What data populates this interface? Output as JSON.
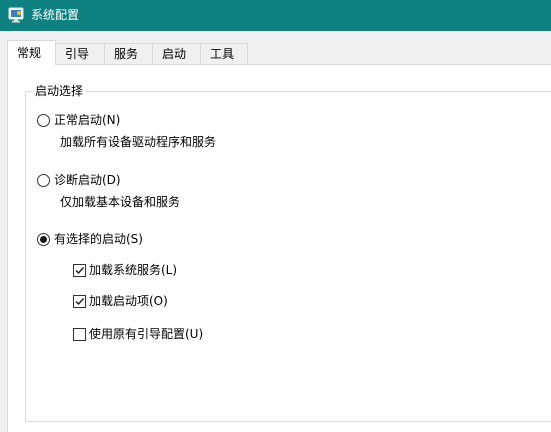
{
  "window": {
    "title": "系统配置",
    "icon": "system-configuration-icon",
    "titlebar_color": "#0f8080"
  },
  "tabs": [
    {
      "label": "常规",
      "active": true
    },
    {
      "label": "引导",
      "active": false
    },
    {
      "label": "服务",
      "active": false
    },
    {
      "label": "启动",
      "active": false
    },
    {
      "label": "工具",
      "active": false
    }
  ],
  "startup_selection": {
    "group_label": "启动选择",
    "options": [
      {
        "label": "正常启动(N)",
        "description": "加载所有设备驱动程序和服务",
        "selected": false
      },
      {
        "label": "诊断启动(D)",
        "description": "仅加载基本设备和服务",
        "selected": false
      },
      {
        "label": "有选择的启动(S)",
        "description": "",
        "selected": true
      }
    ],
    "selective_items": [
      {
        "label": "加载系统服务(L)",
        "checked": true
      },
      {
        "label": "加载启动项(O)",
        "checked": true
      },
      {
        "label": "使用原有引导配置(U)",
        "checked": false
      }
    ]
  }
}
